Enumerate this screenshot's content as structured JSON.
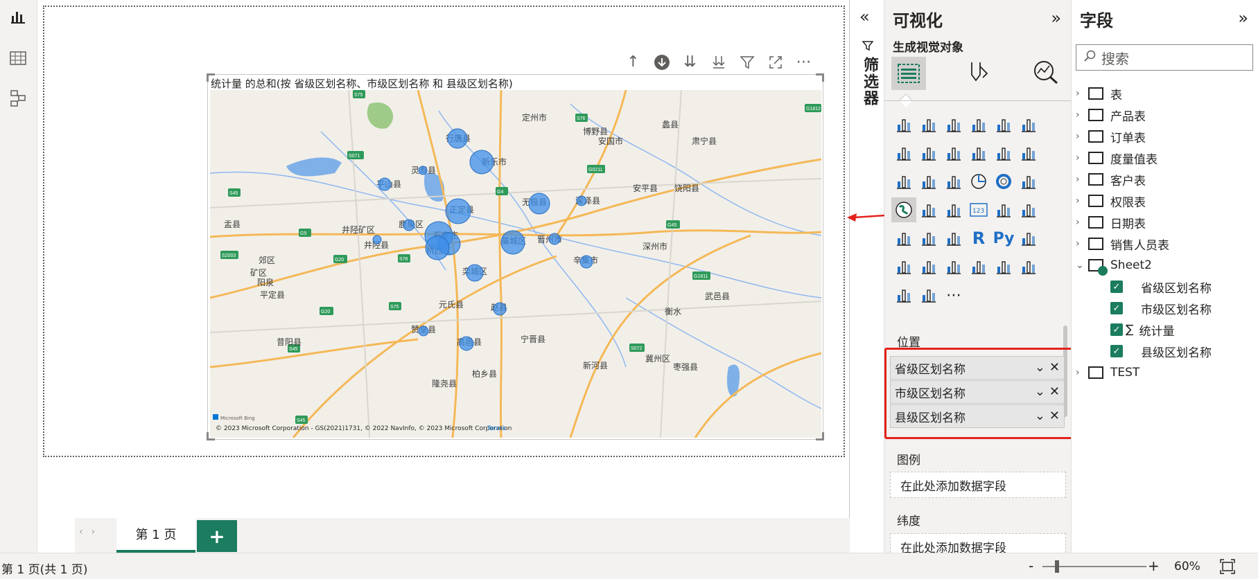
{
  "visual": {
    "title": "统计量 的总和(按 省级区划名称、市级区划名称 和 县级区划名称)",
    "attribution": "© 2023 Microsoft Corporation - GS(2021)1731, © 2022 NavInfo, © 2023 Microsoft Corporation",
    "terms": "Terms",
    "bing": "Microsoft Bing",
    "city_labels": [
      "定州市",
      "行唐县",
      "新乐市",
      "博野县",
      "蠡县",
      "安国市",
      "肃宁县",
      "灵寿县",
      "平山县",
      "无极县",
      "深泽县",
      "安平县",
      "饶阳县",
      "正定县",
      "盂县",
      "井陉矿区",
      "鹿泉区",
      "石家庄",
      "井陉县",
      "桥西区",
      "藁城区",
      "晋州市",
      "深州市",
      "郊区",
      "矿区",
      "阳泉",
      "平定县",
      "栾城区",
      "辛集市",
      "元氏县",
      "赵县",
      "武邑县",
      "衡水",
      "赞皇县",
      "高邑县",
      "宁晋县",
      "昔阳县",
      "新河县",
      "冀州区",
      "枣强县",
      "柏乡县",
      "隆尧县"
    ],
    "road_labels": [
      "S75",
      "G1812",
      "S76",
      "S071",
      "G0211",
      "G4",
      "S45",
      "G45",
      "G5",
      "S2003",
      "G20",
      "S78",
      "S75",
      "G20",
      "G1811",
      "S45",
      "S072",
      "S45",
      "G5"
    ]
  },
  "toolbar": {
    "icons": [
      "arrow-up-icon",
      "drill-down-icon",
      "expand-all-icon",
      "expand-next-icon",
      "filter-icon",
      "focus-mode-icon",
      "more-options-icon"
    ]
  },
  "tabs": {
    "page1": "第 1 页",
    "add": "+"
  },
  "status": {
    "page_info": "第 1 页(共 1 页)",
    "zoom_minus": "-",
    "zoom_plus": "+",
    "zoom": "60%",
    "zoom_level": 0.6
  },
  "filters": {
    "label": "筛选器"
  },
  "viz": {
    "title": "可视化",
    "build": "生成视觉对象",
    "location_label": "位置",
    "location_fields": [
      "省级区划名称",
      "市级区划名称",
      "县级区划名称"
    ],
    "legend_label": "图例",
    "legend_placeholder": "在此处添加数据字段",
    "latitude_label": "纬度",
    "latitude_placeholder": "在此处添加数据字段"
  },
  "fields": {
    "title": "字段",
    "search_placeholder": "搜索",
    "tables": [
      "表",
      "产品表",
      "订单表",
      "度量值表",
      "客户表",
      "权限表",
      "日期表",
      "销售人员表"
    ],
    "sheet2": "Sheet2",
    "sheet2_fields": [
      "省级区划名称",
      "市级区划名称",
      "统计量",
      "县级区划名称"
    ],
    "sum_symbol": "∑",
    "test": "TEST"
  },
  "colors": {
    "accent": "#1b7c5f",
    "bubble": "#3d8fe8",
    "highlight": "#e3231c"
  }
}
